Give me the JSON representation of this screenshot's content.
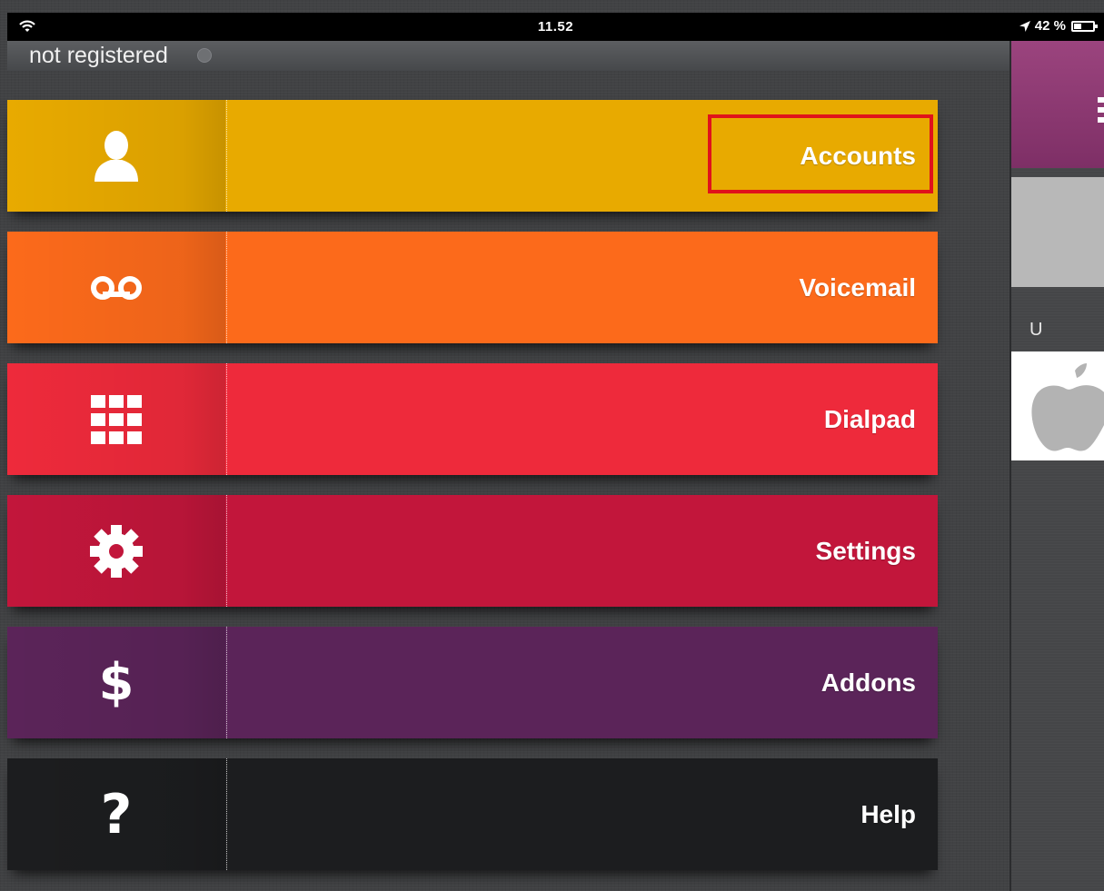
{
  "status_bar": {
    "time": "11.52",
    "battery_text": "42 %",
    "battery_level_percent": 42
  },
  "registration": {
    "status_text": "not registered"
  },
  "menu": {
    "items": [
      {
        "label": "Accounts",
        "icon": "person-icon",
        "color": "#E8AA00"
      },
      {
        "label": "Voicemail",
        "icon": "voicemail-icon",
        "color": "#FC6A1B"
      },
      {
        "label": "Dialpad",
        "icon": "dialpad-icon",
        "color": "#EE2A3B"
      },
      {
        "label": "Settings",
        "icon": "gear-icon",
        "color": "#C2163B"
      },
      {
        "label": "Addons",
        "icon": "dollar-icon",
        "color": "#5B2459"
      },
      {
        "label": "Help",
        "icon": "question-icon",
        "color": "#1C1D1F"
      }
    ],
    "highlighted_item": "Accounts",
    "highlight_color": "#E0121B"
  },
  "right_panel": {
    "section_letter": "U",
    "header_color": "#8D3A73"
  }
}
